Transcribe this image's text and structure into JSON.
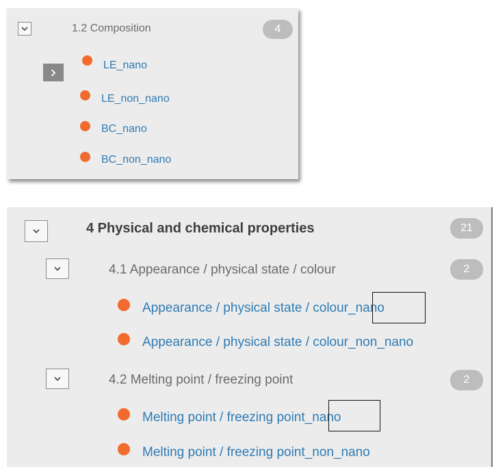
{
  "panel1": {
    "section": {
      "title": "1.2 Composition",
      "count": "4"
    },
    "items": [
      {
        "label": "LE_nano"
      },
      {
        "label": "LE_non_nano"
      },
      {
        "label": "BC_nano"
      },
      {
        "label": "BC_non_nano"
      }
    ]
  },
  "panel2": {
    "section": {
      "title": "4 Physical and chemical properties",
      "count": "21"
    },
    "subsections": [
      {
        "title": "4.1 Appearance / physical state / colour",
        "count": "2",
        "items": [
          {
            "label": "Appearance / physical state / colour_nano"
          },
          {
            "label": "Appearance / physical state / colour_non_nano"
          }
        ]
      },
      {
        "title": "4.2 Melting point / freezing point",
        "count": "2",
        "items": [
          {
            "label": "Melting point / freezing point_nano"
          },
          {
            "label": "Melting point / freezing point_non_nano"
          }
        ]
      }
    ]
  },
  "colors": {
    "dot": "#f26b2e",
    "link": "#2f7bb3",
    "badge": "#bdbdbd",
    "panel_bg": "#ececec"
  },
  "icons": {
    "collapse": "chevron-down-icon",
    "expand": "chevron-right-icon",
    "status": "status-dot-icon"
  }
}
